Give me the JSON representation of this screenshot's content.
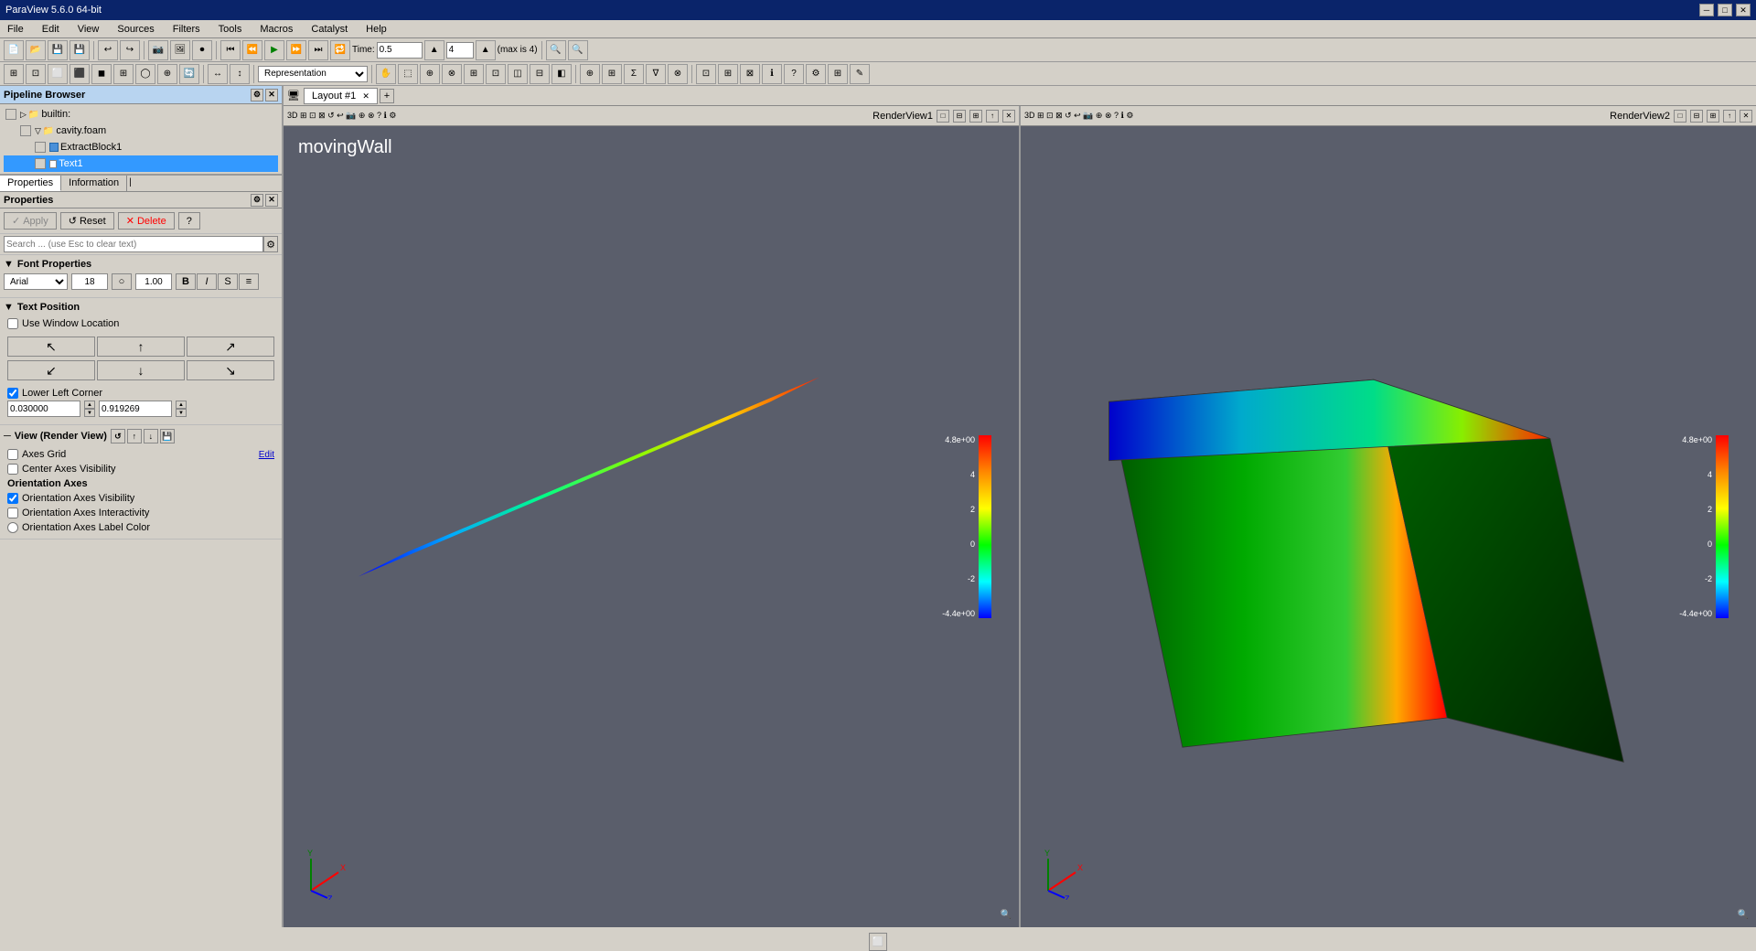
{
  "app": {
    "title": "ParaView 5.6.0 64-bit"
  },
  "menu": {
    "items": [
      "File",
      "Edit",
      "View",
      "Sources",
      "Filters",
      "Tools",
      "Macros",
      "Catalyst",
      "Help"
    ]
  },
  "toolbar": {
    "time_label": "Time:",
    "time_value": "0.5",
    "time_step": "4",
    "time_max": "(max is 4)",
    "representation_label": "Representation"
  },
  "pipeline": {
    "title": "Pipeline Browser",
    "items": [
      {
        "label": "builtin:",
        "level": 0,
        "type": "root"
      },
      {
        "label": "cavity.foam",
        "level": 1,
        "type": "file"
      },
      {
        "label": "ExtractBlock1",
        "level": 2,
        "type": "block"
      },
      {
        "label": "Text1",
        "level": 2,
        "type": "text",
        "selected": true
      }
    ]
  },
  "properties": {
    "tabs": [
      "Properties",
      "Information"
    ],
    "active_tab": "Properties",
    "title": "Properties",
    "buttons": {
      "apply": "Apply",
      "reset": "Reset",
      "delete": "Delete",
      "help": "?"
    },
    "search_placeholder": "Search ... (use Esc to clear text)",
    "font_properties_title": "Font Properties",
    "font_family": "Arial",
    "font_size": "18",
    "font_opacity": "1.00",
    "text_position_title": "Text Position",
    "use_window_location": "Use Window Location",
    "lower_left_corner": "Lower Left Corner",
    "lower_left_x": "0.030000",
    "lower_left_y": "0.919269",
    "view_section_title": "View (Render View)",
    "axes_grid": "Axes Grid",
    "axes_grid_edit": "Edit",
    "center_axes_visibility": "Center Axes Visibility",
    "orientation_axes": "Orientation Axes",
    "orientation_axes_visibility": "Orientation Axes Visibility",
    "orientation_axes_interactivity": "Orientation Axes Interactivity",
    "orientation_axes_label_color": "Orientation Axes Label Color"
  },
  "render_views": [
    {
      "name": "RenderView1",
      "label": "movingWall",
      "colorbar": {
        "max": "4.8e+00",
        "v4": "4",
        "v2": "2",
        "v0": "0",
        "vm2": "-2",
        "min": "-4.4e+00"
      }
    },
    {
      "name": "RenderView2",
      "label": "",
      "colorbar": {
        "max": "4.8e+00",
        "v4": "4",
        "v2": "2",
        "v0": "0",
        "vm2": "-2",
        "min": "-4.4e+00"
      }
    }
  ],
  "tab": {
    "label": "Layout #1",
    "add_label": "+"
  },
  "icons": {
    "bold": "B",
    "italic": "I",
    "strikethrough": "S",
    "align": "≡",
    "check": "✓",
    "arrow_up": "▲",
    "arrow_down": "▼",
    "arrow_left": "◄",
    "arrow_right": "►",
    "refresh": "↺",
    "eye": "👁",
    "close": "✕",
    "minimize": "─",
    "maximize": "□",
    "pin": "📌",
    "gear": "⚙",
    "question": "?",
    "plus": "+",
    "minus": "−",
    "grid": "⊞",
    "up_arrow_nav": "↑",
    "down_arrow_nav": "↓",
    "left_arrow_nav": "←",
    "right_arrow_nav": "→",
    "center": "⊕",
    "topleft": "↖",
    "topright": "↗",
    "bottomleft": "↙",
    "bottomright": "↘",
    "topcenter": "↑",
    "bottomcenter": "↓"
  }
}
